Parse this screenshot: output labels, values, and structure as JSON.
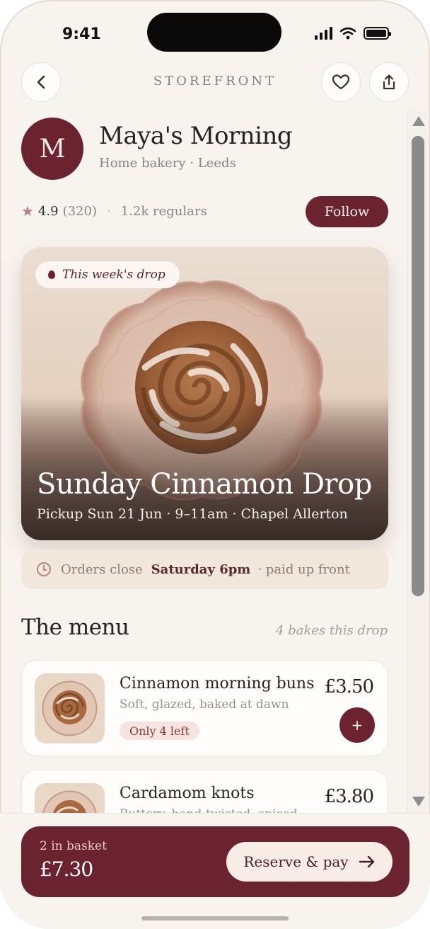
{
  "status_bar": {
    "time": "9:41"
  },
  "header": {
    "title": "STOREFRONT",
    "back_icon": "chevron-left-icon",
    "favorite_icon": "heart-icon",
    "share_icon": "share-icon"
  },
  "shop": {
    "avatar_letter": "M",
    "name": "Maya's Morning",
    "subtitle": "Home bakery · Leeds",
    "rating": "4.9",
    "reviews": "(320)",
    "separator": "·",
    "regulars": "1.2k regulars",
    "follow_label": "Follow"
  },
  "hero": {
    "badge": "This week's drop",
    "title": "Sunday Cinnamon Drop",
    "subtitle": "Pickup Sun 21 Jun · 9–11am · Chapel Allerton"
  },
  "orders_close": {
    "prefix": "Orders close",
    "deadline": "Saturday 6pm",
    "suffix": "· paid up front"
  },
  "menu": {
    "title": "The menu",
    "count": "4 bakes this drop",
    "items": [
      {
        "name": "Cinnamon morning buns",
        "description": "Soft, glazed, baked at dawn",
        "price": "£3.50",
        "badge": "Only 4 left",
        "add_label": "+"
      },
      {
        "name": "Cardamom knots",
        "description": "Buttery, hand-twisted, spiced",
        "price": "£3.80"
      }
    ]
  },
  "basket": {
    "count": "2 in basket",
    "total": "£7.30",
    "cta": "Reserve & pay",
    "cta_icon": "arrow-right-icon"
  },
  "colors": {
    "accent": "#6b2330",
    "background": "#f7f3ee",
    "card": "#fffdfb",
    "badge_bg": "#f5e4df"
  }
}
